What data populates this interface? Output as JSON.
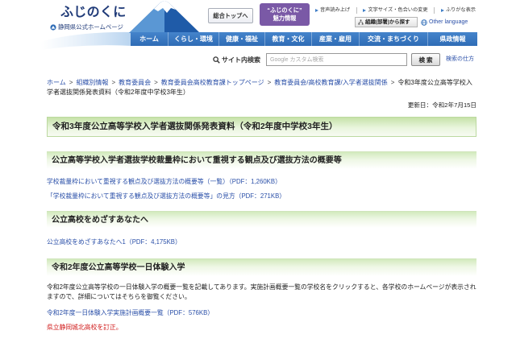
{
  "header": {
    "logo_text": "ふじのくに",
    "logo_subtitle": "静岡県公式ホームページ",
    "top_button": "総合トップへ",
    "attractions": {
      "line1": "“ふじのくに”",
      "line2": "魅力情報"
    },
    "utility_links": [
      "音声読み上げ",
      "文字サイズ・色合いの変更",
      "ふりがな表示"
    ],
    "org_search": "組織(部署)から探す",
    "other_language": "Other language"
  },
  "nav": {
    "items": [
      "ホーム",
      "くらし・環境",
      "健康・福祉",
      "教育・文化",
      "産業・雇用",
      "交流・まちづくり",
      "県政情報"
    ]
  },
  "search": {
    "label": "サイト内検索",
    "placeholder": "Google カスタム検索",
    "button": "検 索",
    "help_link": "検索の仕方"
  },
  "breadcrumb": {
    "separator": ">",
    "links": [
      "ホーム",
      "組織別情報",
      "教育委員会",
      "教育委員会高校教育課トップページ",
      "教育委員会/高校教育課/入学者選抜関係"
    ],
    "current": "令和3年度公立高等学校入学者選抜関係発表資料（令和2年度中学校3年生）"
  },
  "page": {
    "updated": "更新日：令和2年7月15日",
    "title": "令和3年度公立高等学校入学者選抜関係発表資料（令和2年度中学校3年生）"
  },
  "sections": [
    {
      "heading": "公立高等学校入学者選抜学校裁量枠において重視する観点及び選抜方法の概要等",
      "links": [
        "学校裁量枠において重視する観点及び選抜方法の概要等（一覧）（PDF：1,260KB）",
        "「学校裁量枠において重視する観点及び選抜方法の概要等」の見方（PDF：271KB）"
      ]
    },
    {
      "heading": "公立高校をめざすあなたへ",
      "links": [
        "公立高校をめざすあなたへ1（PDF：4,175KB）"
      ]
    },
    {
      "heading": "令和2年度公立高等学校一日体験入学",
      "text": "令和2年度公立高等学校の一日体験入学の概要一覧を記載してあります。実施計画概要一覧の学校名をクリックすると、各学校のホームページが表示されますので、詳細についてはそちらを御覧ください。",
      "links": [
        "令和2年度一日体験入学実施計画概要一覧（PDF：576KB）"
      ],
      "notice": "県立静岡城北高校を訂正。"
    }
  ],
  "icons": {
    "emblem": "prefecture-emblem-icon",
    "search": "search-icon",
    "utility_arrow": "arrow-right-icon",
    "org": "org-chart-icon",
    "language": "globe-icon"
  },
  "colors": {
    "nav_blue": "#2f6cb6",
    "link_blue": "#2a4fa8",
    "notice_red": "#d01a1a",
    "heading_green": "#c6e2a8",
    "attractions_purple": "#7a59a6",
    "logo_navy": "#1f3a78"
  }
}
